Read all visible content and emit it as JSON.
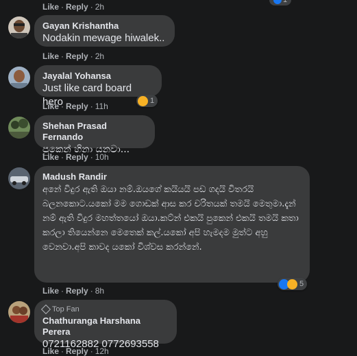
{
  "top_row": {
    "like_label": "Like",
    "reply_label": "Reply",
    "time": "2h",
    "reaction_count": "1"
  },
  "comments": [
    {
      "author": "Gayan Krishantha",
      "text": "Nodakin mewage hiwalek..",
      "like_label": "Like",
      "reply_label": "Reply",
      "time": "2h"
    },
    {
      "author": "Jayalal Yohansa",
      "text": "Just like card board hero",
      "like_label": "Like",
      "reply_label": "Reply",
      "time": "11h",
      "reaction_count": "1"
    },
    {
      "author": "Shehan Prasad Fernando",
      "text": "පුකෙන් හිනා යනවා...",
      "like_label": "Like",
      "reply_label": "Reply",
      "time": "10h"
    },
    {
      "author": "Madush Randir",
      "text": "අනේ විදුර ඇති ඔයා නම්.ඔයගේ කයියයි පඩ ගදයි විතරයි බලනකොට.යකෝ මම ගොඩක් ආස කර චරිතයක් තමයි මෙතුමා.දැන් නම් ඇති විදුර මහත්තයෝ ඔයා.කට්න් එකයි පුකෙන් එකයි තමයි කතා කරලා තියෙන්නෙ මෙතෙක් කල්.යකෝ අපි හැමදම මුත්ට අහු වෙනවා.අපි කාවද යකෝ විශ්වස කරන්නේ.",
      "like_label": "Like",
      "reply_label": "Reply",
      "time": "8h",
      "reaction_count": "5"
    },
    {
      "badge": "Top Fan",
      "author": "Chathuranga Harshana Perera",
      "text": "0721162882 0772693558",
      "like_label": "Like",
      "reply_label": "Reply",
      "time": "12h"
    }
  ],
  "colors": {
    "background": "#18191a",
    "bubble": "#3a3b3c",
    "text": "#e4e6eb",
    "muted": "#b0b3b8",
    "like_blue": "#1877f2",
    "haha_yellow": "#f7b125"
  }
}
